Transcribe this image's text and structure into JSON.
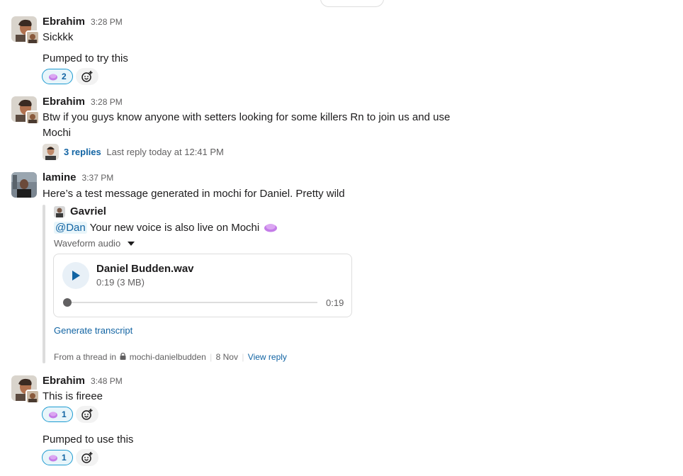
{
  "messages": [
    {
      "author": "Ebrahim",
      "time": "3:28 PM",
      "lines": [
        "Sickkk"
      ],
      "followup": "Pumped to try this",
      "reaction": {
        "emoji": "mochi-emoji",
        "count": "2"
      }
    },
    {
      "author": "Ebrahim",
      "time": "3:28 PM",
      "lines": [
        "Btw if you guys know anyone with setters looking for some killers Rn to join us and use",
        "Mochi"
      ],
      "thread": {
        "replies": "3 replies",
        "last_reply": "Last reply today at 12:41 PM"
      }
    },
    {
      "author": "lamine",
      "time": "3:37 PM",
      "lines": [
        "Here’s a test message generated in mochi for Daniel. Pretty wild"
      ],
      "shared": {
        "author": "Gavriel",
        "mention": "@Dan",
        "text": " Your new voice is also live on Mochi",
        "attachment_label": "Waveform audio",
        "file": {
          "name": "Daniel Budden.wav",
          "meta": "0:19 (3 MB)",
          "duration": "0:19",
          "progress": 0
        },
        "generate_transcript": "Generate transcript",
        "footer": {
          "prefix": "From a thread in",
          "channel": "mochi-danielbudden",
          "date": "8 Nov",
          "view_reply": "View reply"
        }
      }
    },
    {
      "author": "Ebrahim",
      "time": "3:48 PM",
      "lines": [
        "This is fireee"
      ],
      "reaction": {
        "emoji": "mochi-emoji",
        "count": "1"
      },
      "followup": "Pumped to use this",
      "followup_reaction": {
        "emoji": "mochi-emoji",
        "count": "1"
      }
    }
  ],
  "colors": {
    "link": "#1264a3",
    "reaction_border": "#1d9bd1",
    "mochi": "#c47ce8"
  }
}
